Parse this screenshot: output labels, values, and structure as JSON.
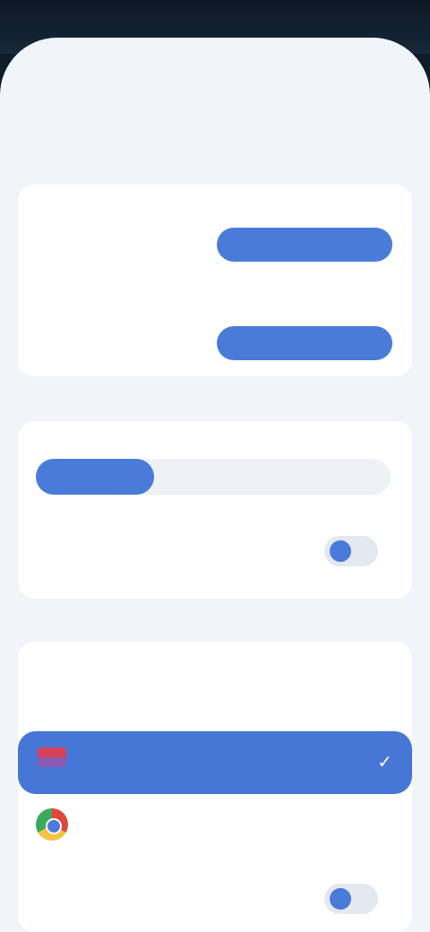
{
  "status": {
    "time": "",
    "icons": ""
  },
  "header": {
    "title_light": "",
    "title_bold": ""
  },
  "sections": {
    "s1": "",
    "s2": "",
    "s3": ""
  },
  "card1": {
    "row1": {
      "title": "",
      "subtitle": "",
      "button": ""
    },
    "row2": {
      "title": "",
      "subtitle": "",
      "button": ""
    }
  },
  "card2": {
    "label": "",
    "segments": [
      "",
      ""
    ],
    "toggle_label": ""
  },
  "card3": {
    "title": "",
    "subtitle": "",
    "selected_item": "",
    "item2": "",
    "toggle_label": ""
  },
  "colors": {
    "accent": "#4a7bd8",
    "background": "#f1f4f8"
  },
  "icons": {
    "check": "check-icon",
    "browser": "chrome-icon",
    "flag": "flag-icon"
  }
}
